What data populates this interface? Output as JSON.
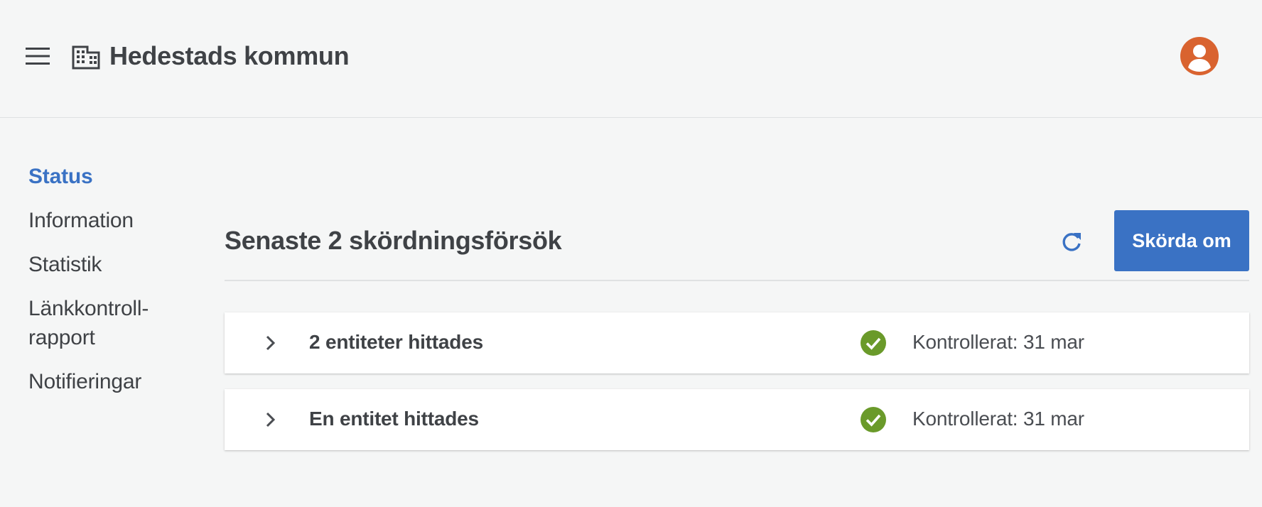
{
  "header": {
    "org_name": "Hedestads kommun",
    "menu_icon": "hamburger-icon",
    "org_icon": "building-icon",
    "avatar_icon": "user-avatar-icon",
    "avatar_color": "#d9632f"
  },
  "sidebar": {
    "items": [
      {
        "label": "Status",
        "active": true
      },
      {
        "label": "Information",
        "active": false
      },
      {
        "label": "Statistik",
        "active": false
      },
      {
        "label": "Länkkontroll-",
        "label2": "rapport",
        "active": false
      },
      {
        "label": "Notifieringar",
        "active": false
      }
    ]
  },
  "main": {
    "heading": "Senaste 2 skördningsförsök",
    "refresh_icon": "refresh-icon",
    "reharvest_label": "Skörda om",
    "attempts": [
      {
        "title": "2 entiteter hittades",
        "checked": "Kontrollerat: 31 mar",
        "status": "success"
      },
      {
        "title": "En entitet hittades",
        "checked": "Kontrollerat: 31 mar",
        "status": "success"
      }
    ]
  },
  "colors": {
    "accent": "#3a72c4",
    "success": "#6a9a2a",
    "avatar": "#d9632f",
    "background": "#f5f6f6"
  }
}
